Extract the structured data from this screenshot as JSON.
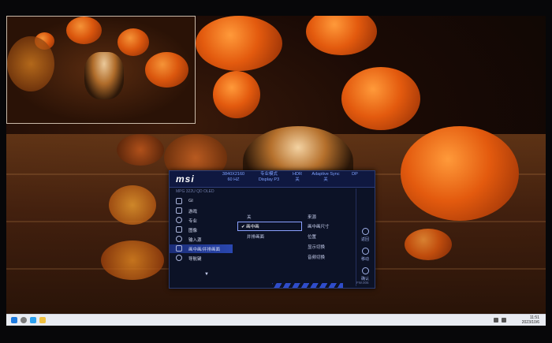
{
  "osd": {
    "brand": "msi",
    "model": "MPG 322U QD OLED",
    "status": [
      {
        "line1": "3840X2160",
        "line2": "60 HZ"
      },
      {
        "line1": "专业模式",
        "line2": "Display P3"
      },
      {
        "line1": "HDR",
        "line2": "关"
      },
      {
        "line1": "Adaptive Sync",
        "line2": "关"
      },
      {
        "line1": "DP",
        "line2": ""
      }
    ],
    "menu": [
      {
        "label": "GI",
        "icon": "gi-icon"
      },
      {
        "label": "游戏",
        "icon": "gamepad-icon"
      },
      {
        "label": "专业",
        "icon": "professional-icon"
      },
      {
        "label": "图像",
        "icon": "image-icon"
      },
      {
        "label": "输入源",
        "icon": "input-source-icon"
      },
      {
        "label": "画中画/并排画面",
        "icon": "pip-icon"
      },
      {
        "label": "导航键",
        "icon": "navigation-icon"
      }
    ],
    "submenu": {
      "off": "关",
      "pip": "画中画",
      "pbp": "并排画面"
    },
    "options": [
      "来源",
      "画中画尺寸",
      "位置",
      "显示切换",
      "音频切换"
    ],
    "side": [
      {
        "label": "返回",
        "icon": "back-icon"
      },
      {
        "label": "移动",
        "icon": "move-icon"
      },
      {
        "label": "确认",
        "icon": "confirm-icon"
      }
    ],
    "firmware": "FW.006"
  },
  "taskbar": {
    "time": "11:51",
    "date": "2023/10/6"
  }
}
